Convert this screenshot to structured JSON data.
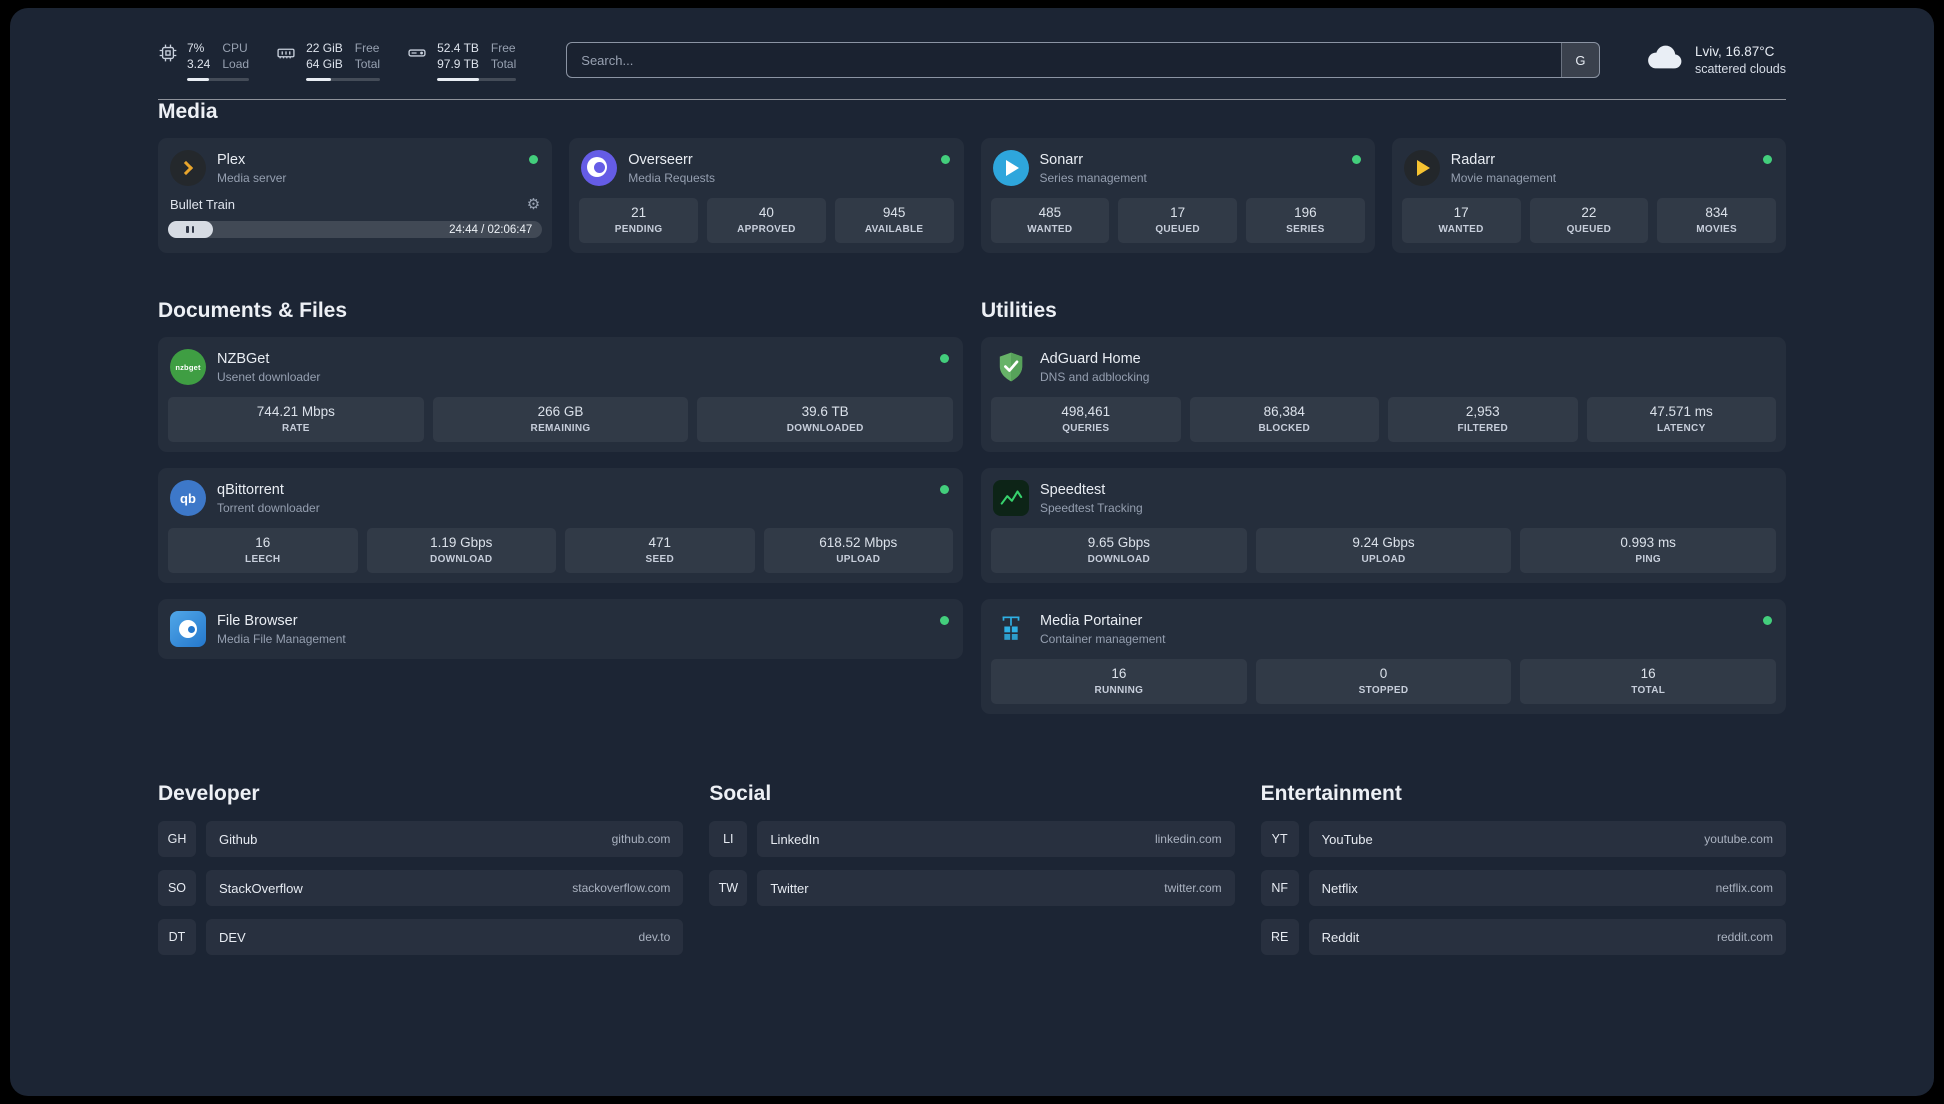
{
  "colors": {
    "panel_bg": "#1c2534",
    "card_bg": "#242d3c",
    "status_online": "#43ce7c",
    "plex_accent": "#e8a52c",
    "overseerr_accent": "#655ce6",
    "sonarr_accent": "#2ea6dc",
    "radarr_accent": "#f6c331",
    "nzbget_accent": "#3f9e43",
    "qbittorrent_accent": "#3d78c9",
    "filebrowser_accent": "#2477cc",
    "adguard_accent": "#67b368",
    "speedtest_accent": "#37d26d",
    "portainer_accent": "#2fb0e4"
  },
  "topbar": {
    "resources": [
      {
        "icon": "cpu-icon",
        "value_top": "7%",
        "value_bottom": "3.24",
        "label_top": "CPU",
        "label_bottom": "Load",
        "percent": 35
      },
      {
        "icon": "memory-icon",
        "value_top": "22 GiB",
        "value_bottom": "64 GiB",
        "label_top": "Free",
        "label_bottom": "Total",
        "percent": 34
      },
      {
        "icon": "disk-icon",
        "value_top": "52.4 TB",
        "value_bottom": "97.9 TB",
        "label_top": "Free",
        "label_bottom": "Total",
        "percent": 53
      }
    ],
    "search": {
      "placeholder": "Search...",
      "engine_button": "G"
    },
    "weather": {
      "icon": "cloud-icon",
      "location": "Lviv, 16.87°C",
      "condition": "scattered clouds"
    }
  },
  "sections": {
    "media": {
      "title": "Media",
      "plex": {
        "icon": "plex-icon",
        "name": "Plex",
        "subtitle": "Media server",
        "status": "online",
        "now_playing": "Bullet Train",
        "time": "24:44 / 02:06:47",
        "progress_percent": 12
      },
      "overseerr": {
        "icon": "overseerr-icon",
        "name": "Overseerr",
        "subtitle": "Media Requests",
        "status": "online",
        "stats": [
          {
            "value": "21",
            "label": "PENDING"
          },
          {
            "value": "40",
            "label": "APPROVED"
          },
          {
            "value": "945",
            "label": "AVAILABLE"
          }
        ]
      },
      "sonarr": {
        "icon": "sonarr-icon",
        "name": "Sonarr",
        "subtitle": "Series management",
        "status": "online",
        "stats": [
          {
            "value": "485",
            "label": "WANTED"
          },
          {
            "value": "17",
            "label": "QUEUED"
          },
          {
            "value": "196",
            "label": "SERIES"
          }
        ]
      },
      "radarr": {
        "icon": "radarr-icon",
        "name": "Radarr",
        "subtitle": "Movie management",
        "status": "online",
        "stats": [
          {
            "value": "17",
            "label": "WANTED"
          },
          {
            "value": "22",
            "label": "QUEUED"
          },
          {
            "value": "834",
            "label": "MOVIES"
          }
        ]
      }
    },
    "documents": {
      "title": "Documents & Files",
      "nzbget": {
        "icon": "nzbget-icon",
        "icon_text": "nzbget",
        "name": "NZBGet",
        "subtitle": "Usenet downloader",
        "status": "online",
        "stats": [
          {
            "value": "744.21 Mbps",
            "label": "RATE"
          },
          {
            "value": "266 GB",
            "label": "REMAINING"
          },
          {
            "value": "39.6 TB",
            "label": "DOWNLOADED"
          }
        ]
      },
      "qbittorrent": {
        "icon": "qbittorrent-icon",
        "icon_text": "qb",
        "name": "qBittorrent",
        "subtitle": "Torrent downloader",
        "status": "online",
        "stats": [
          {
            "value": "16",
            "label": "LEECH"
          },
          {
            "value": "1.19 Gbps",
            "label": "DOWNLOAD"
          },
          {
            "value": "471",
            "label": "SEED"
          },
          {
            "value": "618.52 Mbps",
            "label": "UPLOAD"
          }
        ]
      },
      "filebrowser": {
        "icon": "filebrowser-icon",
        "name": "File Browser",
        "subtitle": "Media File Management",
        "status": "online"
      }
    },
    "utilities": {
      "title": "Utilities",
      "adguard": {
        "icon": "adguard-icon",
        "name": "AdGuard Home",
        "subtitle": "DNS and adblocking",
        "stats": [
          {
            "value": "498,461",
            "label": "QUERIES"
          },
          {
            "value": "86,384",
            "label": "BLOCKED"
          },
          {
            "value": "2,953",
            "label": "FILTERED"
          },
          {
            "value": "47.571 ms",
            "label": "LATENCY"
          }
        ]
      },
      "speedtest": {
        "icon": "speedtest-icon",
        "name": "Speedtest",
        "subtitle": "Speedtest Tracking",
        "stats": [
          {
            "value": "9.65 Gbps",
            "label": "DOWNLOAD"
          },
          {
            "value": "9.24 Gbps",
            "label": "UPLOAD"
          },
          {
            "value": "0.993 ms",
            "label": "PING"
          }
        ]
      },
      "portainer": {
        "icon": "portainer-icon",
        "name": "Media Portainer",
        "subtitle": "Container management",
        "status": "online",
        "stats": [
          {
            "value": "16",
            "label": "RUNNING"
          },
          {
            "value": "0",
            "label": "STOPPED"
          },
          {
            "value": "16",
            "label": "TOTAL"
          }
        ]
      }
    }
  },
  "bookmarks": {
    "developer": {
      "title": "Developer",
      "items": [
        {
          "abbr": "GH",
          "name": "Github",
          "domain": "github.com"
        },
        {
          "abbr": "SO",
          "name": "StackOverflow",
          "domain": "stackoverflow.com"
        },
        {
          "abbr": "DT",
          "name": "DEV",
          "domain": "dev.to"
        }
      ]
    },
    "social": {
      "title": "Social",
      "items": [
        {
          "abbr": "LI",
          "name": "LinkedIn",
          "domain": "linkedin.com"
        },
        {
          "abbr": "TW",
          "name": "Twitter",
          "domain": "twitter.com"
        }
      ]
    },
    "entertainment": {
      "title": "Entertainment",
      "items": [
        {
          "abbr": "YT",
          "name": "YouTube",
          "domain": "youtube.com"
        },
        {
          "abbr": "NF",
          "name": "Netflix",
          "domain": "netflix.com"
        },
        {
          "abbr": "RE",
          "name": "Reddit",
          "domain": "reddit.com"
        }
      ]
    }
  }
}
